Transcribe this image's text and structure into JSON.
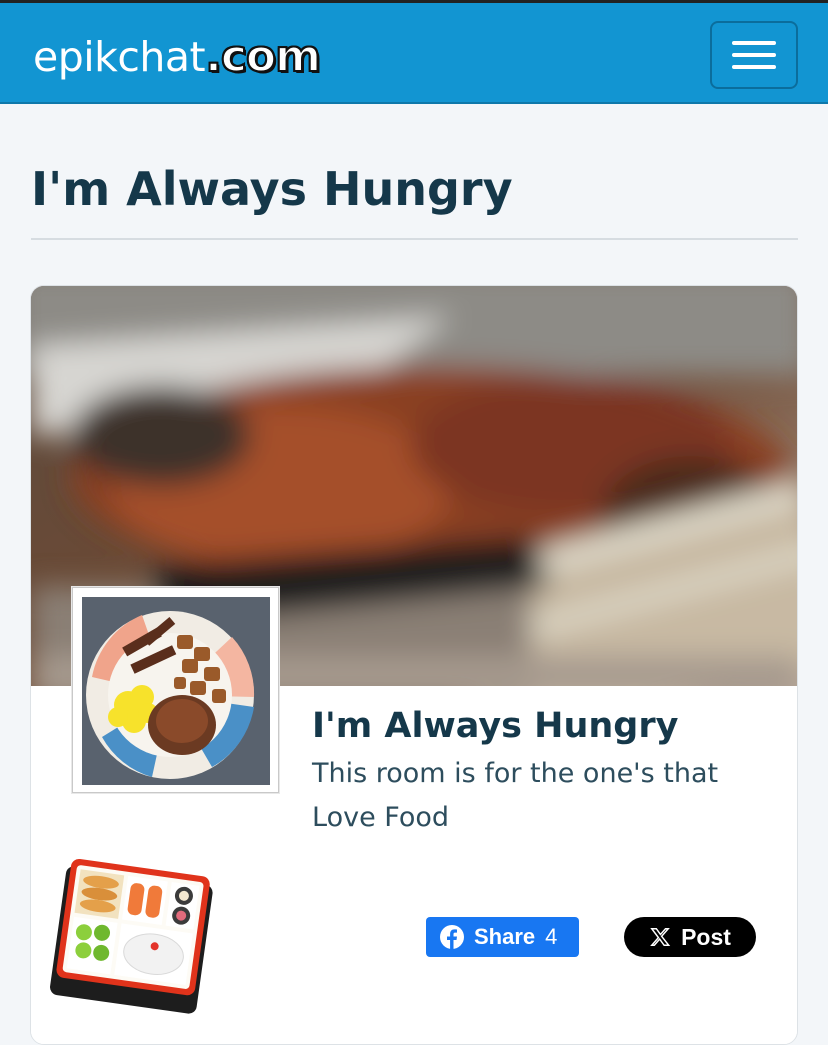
{
  "navbar": {
    "brand_main": "epikchat",
    "brand_tld": ".com",
    "menu_icon": "hamburger-menu-icon"
  },
  "page": {
    "title": "I'm Always Hungry"
  },
  "room": {
    "name": "I'm Always Hungry",
    "description": "This room is for the one's that Love Food",
    "cover_image": "blurred-food-cover-photo",
    "avatar_image": "plate-of-breakfast-photo",
    "emoji_icon": "bento-box-icon"
  },
  "social": {
    "fb_label": "Share",
    "fb_count": "4",
    "fb_icon": "facebook-icon",
    "x_label": "Post",
    "x_icon": "x-logo-icon",
    "fb_color": "#1877f2",
    "x_color": "#000000"
  },
  "colors": {
    "navbar": "#1295d2",
    "title_text": "#15384a",
    "background": "#f3f6f9"
  }
}
